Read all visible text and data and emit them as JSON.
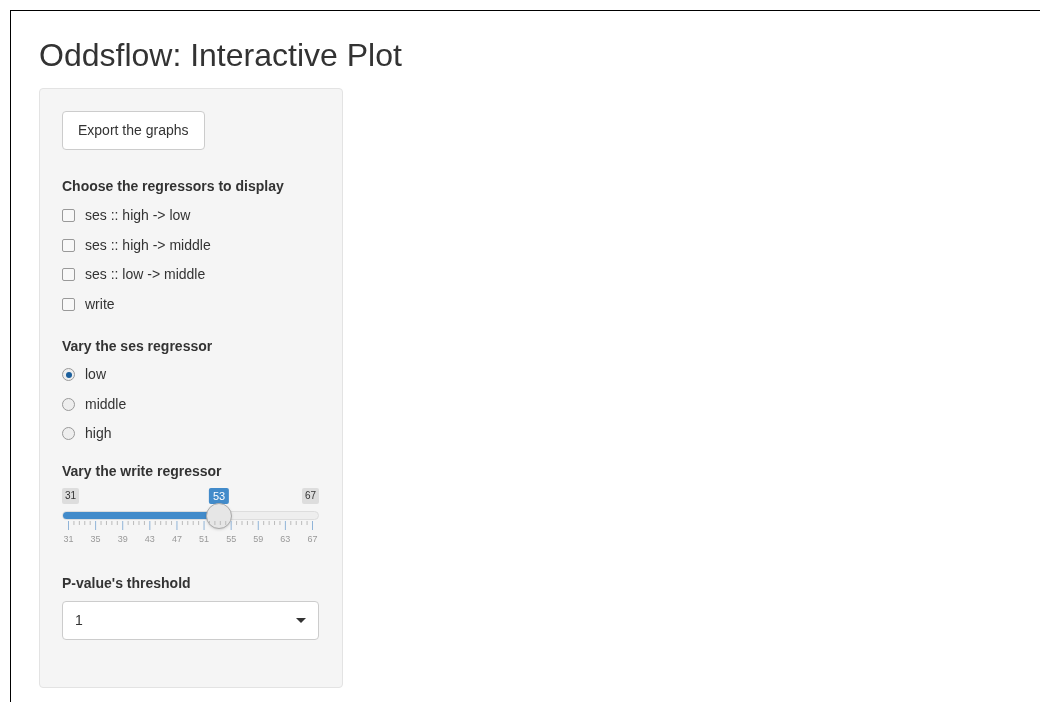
{
  "title": "Oddsflow: Interactive Plot",
  "export_button": "Export the graphs",
  "regressors": {
    "label": "Choose the regressors to display",
    "options": [
      {
        "label": "ses :: high -> low",
        "checked": false
      },
      {
        "label": "ses :: high -> middle",
        "checked": false
      },
      {
        "label": "ses :: low -> middle",
        "checked": false
      },
      {
        "label": "write",
        "checked": false
      }
    ]
  },
  "ses": {
    "label": "Vary the ses regressor",
    "options": [
      {
        "label": "low",
        "selected": true
      },
      {
        "label": "middle",
        "selected": false
      },
      {
        "label": "high",
        "selected": false
      }
    ]
  },
  "write": {
    "label": "Vary the write regressor",
    "min_label": "31",
    "max_label": "67",
    "value_label": "53",
    "level": 0.611,
    "ticks": [
      "31",
      "35",
      "39",
      "43",
      "47",
      "51",
      "55",
      "59",
      "63",
      "67"
    ]
  },
  "pvalue": {
    "label": "P-value's threshold",
    "value": "1"
  }
}
